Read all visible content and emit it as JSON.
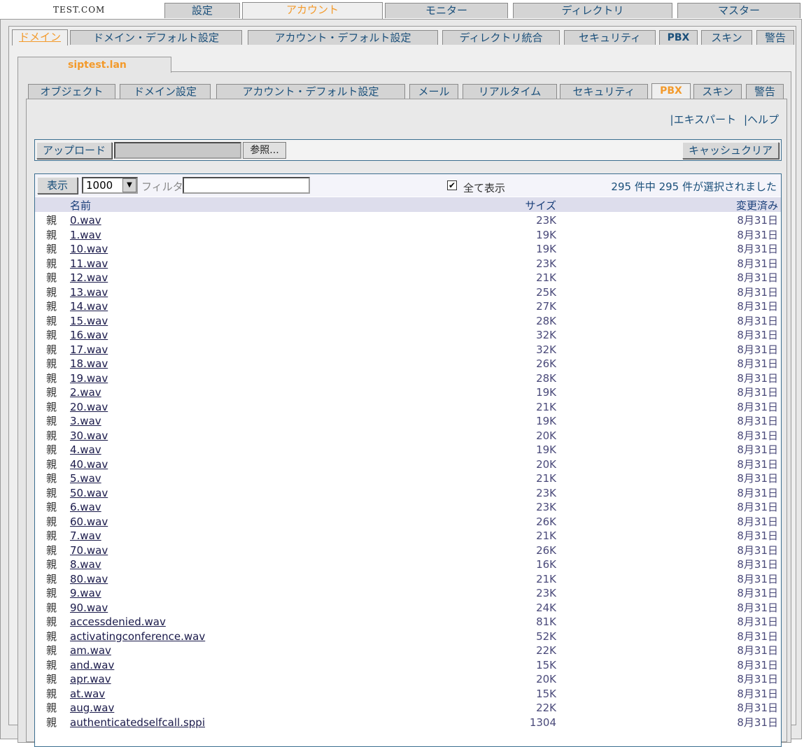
{
  "server_name": "TEST.COM",
  "top_tabs": [
    {
      "label": "設定"
    },
    {
      "label": "アカウント"
    },
    {
      "label": "モニター"
    },
    {
      "label": "ディレクトリ"
    },
    {
      "label": "マスター"
    }
  ],
  "sub_tabs": [
    {
      "label": "ドメイン"
    },
    {
      "label": "ドメイン・デフォルト設定"
    },
    {
      "label": "アカウント・デフォルト設定"
    },
    {
      "label": "ディレクトリ統合"
    },
    {
      "label": "セキュリティ"
    },
    {
      "label": "PBX"
    },
    {
      "label": "スキン"
    },
    {
      "label": "警告"
    }
  ],
  "domain_name": "siptest.lan",
  "domain_tabs": [
    {
      "label": "オブジェクト"
    },
    {
      "label": "ドメイン設定"
    },
    {
      "label": "アカウント・デフォルト設定"
    },
    {
      "label": "メール"
    },
    {
      "label": "リアルタイム"
    },
    {
      "label": "セキュリティ"
    },
    {
      "label": "PBX"
    },
    {
      "label": "スキン"
    },
    {
      "label": "警告"
    }
  ],
  "help_links": {
    "expert": "|エキスパート",
    "help": "|ヘルプ"
  },
  "upload": {
    "upload_label": "アップロード",
    "browse_label": "参照...",
    "clear_cache_label": "キャッシュクリア"
  },
  "list_controls": {
    "show_label": "表示",
    "page_size": "1000",
    "filter_label": "フィルタ:",
    "filter_value": "",
    "show_all_checked": "✔",
    "show_all_label": "全て表示",
    "selected_info": "295 件中 295 件が選択されました"
  },
  "columns": {
    "name": "名前",
    "size": "サイズ",
    "modified": "変更済み"
  },
  "files": [
    {
      "kind": "親",
      "name": "0.wav",
      "size": "23K",
      "date": "8月31日"
    },
    {
      "kind": "親",
      "name": "1.wav",
      "size": "19K",
      "date": "8月31日"
    },
    {
      "kind": "親",
      "name": "10.wav",
      "size": "19K",
      "date": "8月31日"
    },
    {
      "kind": "親",
      "name": "11.wav",
      "size": "23K",
      "date": "8月31日"
    },
    {
      "kind": "親",
      "name": "12.wav",
      "size": "21K",
      "date": "8月31日"
    },
    {
      "kind": "親",
      "name": "13.wav",
      "size": "25K",
      "date": "8月31日"
    },
    {
      "kind": "親",
      "name": "14.wav",
      "size": "27K",
      "date": "8月31日"
    },
    {
      "kind": "親",
      "name": "15.wav",
      "size": "28K",
      "date": "8月31日"
    },
    {
      "kind": "親",
      "name": "16.wav",
      "size": "32K",
      "date": "8月31日"
    },
    {
      "kind": "親",
      "name": "17.wav",
      "size": "32K",
      "date": "8月31日"
    },
    {
      "kind": "親",
      "name": "18.wav",
      "size": "26K",
      "date": "8月31日"
    },
    {
      "kind": "親",
      "name": "19.wav",
      "size": "28K",
      "date": "8月31日"
    },
    {
      "kind": "親",
      "name": "2.wav",
      "size": "19K",
      "date": "8月31日"
    },
    {
      "kind": "親",
      "name": "20.wav",
      "size": "21K",
      "date": "8月31日"
    },
    {
      "kind": "親",
      "name": "3.wav",
      "size": "19K",
      "date": "8月31日"
    },
    {
      "kind": "親",
      "name": "30.wav",
      "size": "20K",
      "date": "8月31日"
    },
    {
      "kind": "親",
      "name": "4.wav",
      "size": "19K",
      "date": "8月31日"
    },
    {
      "kind": "親",
      "name": "40.wav",
      "size": "20K",
      "date": "8月31日"
    },
    {
      "kind": "親",
      "name": "5.wav",
      "size": "21K",
      "date": "8月31日"
    },
    {
      "kind": "親",
      "name": "50.wav",
      "size": "23K",
      "date": "8月31日"
    },
    {
      "kind": "親",
      "name": "6.wav",
      "size": "23K",
      "date": "8月31日"
    },
    {
      "kind": "親",
      "name": "60.wav",
      "size": "26K",
      "date": "8月31日"
    },
    {
      "kind": "親",
      "name": "7.wav",
      "size": "21K",
      "date": "8月31日"
    },
    {
      "kind": "親",
      "name": "70.wav",
      "size": "26K",
      "date": "8月31日"
    },
    {
      "kind": "親",
      "name": "8.wav",
      "size": "16K",
      "date": "8月31日"
    },
    {
      "kind": "親",
      "name": "80.wav",
      "size": "21K",
      "date": "8月31日"
    },
    {
      "kind": "親",
      "name": "9.wav",
      "size": "23K",
      "date": "8月31日"
    },
    {
      "kind": "親",
      "name": "90.wav",
      "size": "24K",
      "date": "8月31日"
    },
    {
      "kind": "親",
      "name": "accessdenied.wav",
      "size": "81K",
      "date": "8月31日"
    },
    {
      "kind": "親",
      "name": "activatingconference.wav",
      "size": "52K",
      "date": "8月31日"
    },
    {
      "kind": "親",
      "name": "am.wav",
      "size": "22K",
      "date": "8月31日"
    },
    {
      "kind": "親",
      "name": "and.wav",
      "size": "15K",
      "date": "8月31日"
    },
    {
      "kind": "親",
      "name": "apr.wav",
      "size": "20K",
      "date": "8月31日"
    },
    {
      "kind": "親",
      "name": "at.wav",
      "size": "15K",
      "date": "8月31日"
    },
    {
      "kind": "親",
      "name": "aug.wav",
      "size": "22K",
      "date": "8月31日"
    },
    {
      "kind": "親",
      "name": "authenticatedselfcall.sppi",
      "size": "1304",
      "date": "8月31日"
    }
  ]
}
